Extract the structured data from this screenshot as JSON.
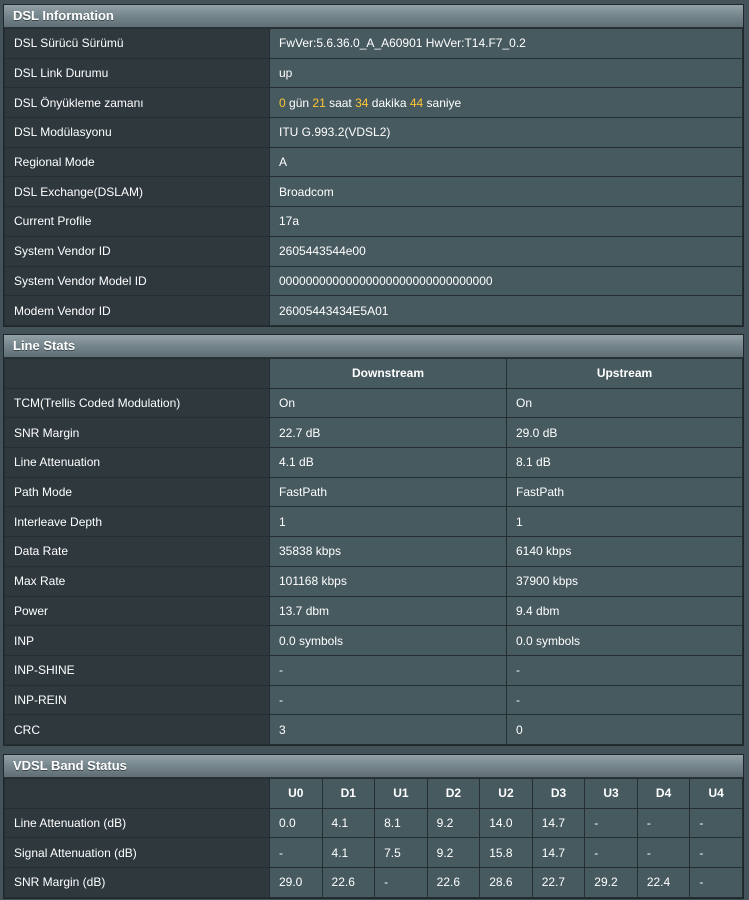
{
  "dsl_info": {
    "title": "DSL Information",
    "rows": [
      {
        "label": "DSL Sürücü Sürümü",
        "value": "FwVer:5.6.36.0_A_A60901 HwVer:T14.F7_0.2"
      },
      {
        "label": "DSL Link Durumu",
        "value": "up"
      },
      {
        "label": "DSL Önyükleme zamanı",
        "uptime": {
          "days": "0",
          "days_unit": " gün ",
          "hours": "21",
          "hours_unit": " saat ",
          "minutes": "34",
          "minutes_unit": " dakika ",
          "seconds": "44",
          "seconds_unit": " saniye"
        }
      },
      {
        "label": "DSL Modülasyonu",
        "value": "ITU G.993.2(VDSL2)"
      },
      {
        "label": "Regional Mode",
        "value": "A"
      },
      {
        "label": "DSL Exchange(DSLAM)",
        "value": "Broadcom"
      },
      {
        "label": "Current Profile",
        "value": "17a"
      },
      {
        "label": "System Vendor ID",
        "value": "2605443544e00"
      },
      {
        "label": "System Vendor Model ID",
        "value": "00000000000000000000000000000000"
      },
      {
        "label": "Modem Vendor ID",
        "value": "26005443434E5A01"
      }
    ]
  },
  "line_stats": {
    "title": "Line Stats",
    "columns": [
      "Downstream",
      "Upstream"
    ],
    "rows": [
      {
        "label": "TCM(Trellis Coded Modulation)",
        "down": "On",
        "up": "On"
      },
      {
        "label": "SNR Margin",
        "down": "22.7 dB",
        "up": "29.0 dB"
      },
      {
        "label": "Line Attenuation",
        "down": "4.1 dB",
        "up": "8.1 dB"
      },
      {
        "label": "Path Mode",
        "down": "FastPath",
        "up": "FastPath"
      },
      {
        "label": "Interleave Depth",
        "down": "1",
        "up": "1"
      },
      {
        "label": "Data Rate",
        "down": "35838 kbps",
        "up": "6140 kbps"
      },
      {
        "label": "Max Rate",
        "down": "101168 kbps",
        "up": "37900 kbps"
      },
      {
        "label": "Power",
        "down": "13.7 dbm",
        "up": "9.4 dbm"
      },
      {
        "label": "INP",
        "down": "0.0 symbols",
        "up": "0.0 symbols"
      },
      {
        "label": "INP-SHINE",
        "down": "-",
        "up": "-"
      },
      {
        "label": "INP-REIN",
        "down": "-",
        "up": "-"
      },
      {
        "label": "CRC",
        "down": "3",
        "up": "0"
      }
    ]
  },
  "band_status": {
    "title": "VDSL Band Status",
    "bands": [
      "U0",
      "D1",
      "U1",
      "D2",
      "U2",
      "D3",
      "U3",
      "D4",
      "U4"
    ],
    "rows": [
      {
        "label": "Line Attenuation (dB)",
        "values": [
          "0.0",
          "4.1",
          "8.1",
          "9.2",
          "14.0",
          "14.7",
          "-",
          "-",
          "-"
        ]
      },
      {
        "label": "Signal Attenuation (dB)",
        "values": [
          "-",
          "4.1",
          "7.5",
          "9.2",
          "15.8",
          "14.7",
          "-",
          "-",
          "-"
        ]
      },
      {
        "label": "SNR Margin (dB)",
        "values": [
          "29.0",
          "22.6",
          "-",
          "22.6",
          "28.6",
          "22.7",
          "29.2",
          "22.4",
          "-"
        ]
      }
    ]
  },
  "colors": {
    "upstream_band": "#2eb4ea",
    "downstream_band": "#f08a3c",
    "uptime_highlight": "#ffc630"
  }
}
